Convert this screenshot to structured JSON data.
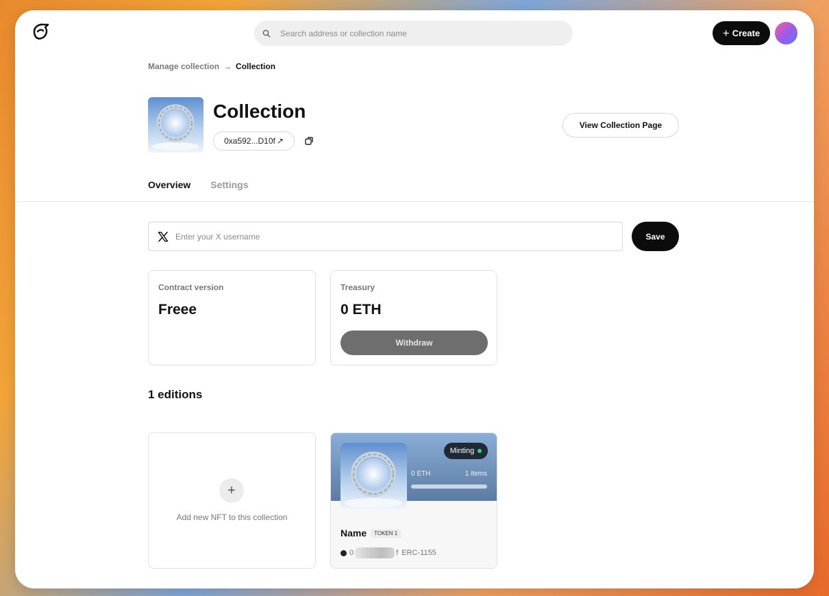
{
  "header": {
    "search_placeholder": "Search address or collection name",
    "create_label": "Create",
    "create_icon": "plus-icon",
    "logo": "app-logo"
  },
  "breadcrumb": {
    "parent": "Manage collection",
    "separator": "→",
    "current": "Collection"
  },
  "collection": {
    "title": "Collection",
    "address": "0xa592...D10f",
    "address_arrow": "↗",
    "view_button": "View Collection Page"
  },
  "tabs": [
    {
      "label": "Overview",
      "active": true
    },
    {
      "label": "Settings",
      "active": false
    }
  ],
  "social": {
    "x_placeholder": "Enter your X username",
    "save_label": "Save"
  },
  "stats": {
    "contract_label": "Contract version",
    "contract_value": "Freee",
    "treasury_label": "Treasury",
    "treasury_value": "0 ETH",
    "withdraw_label": "Withdraw"
  },
  "editions": {
    "heading": "1 editions",
    "add_label": "Add new NFT to this collection",
    "add_icon": "+",
    "nft": {
      "status": "Minting",
      "price": "0 ETH",
      "items": "1 items",
      "progress": 0,
      "name": "Name",
      "token": "TOKEN 1",
      "address_start": "0",
      "address_end": "f",
      "standard": "ERC-1155"
    }
  },
  "colors": {
    "primary": "#0c0c0c",
    "minting_dot": "#2fd38a",
    "withdraw_bg": "#6e6e6e"
  }
}
